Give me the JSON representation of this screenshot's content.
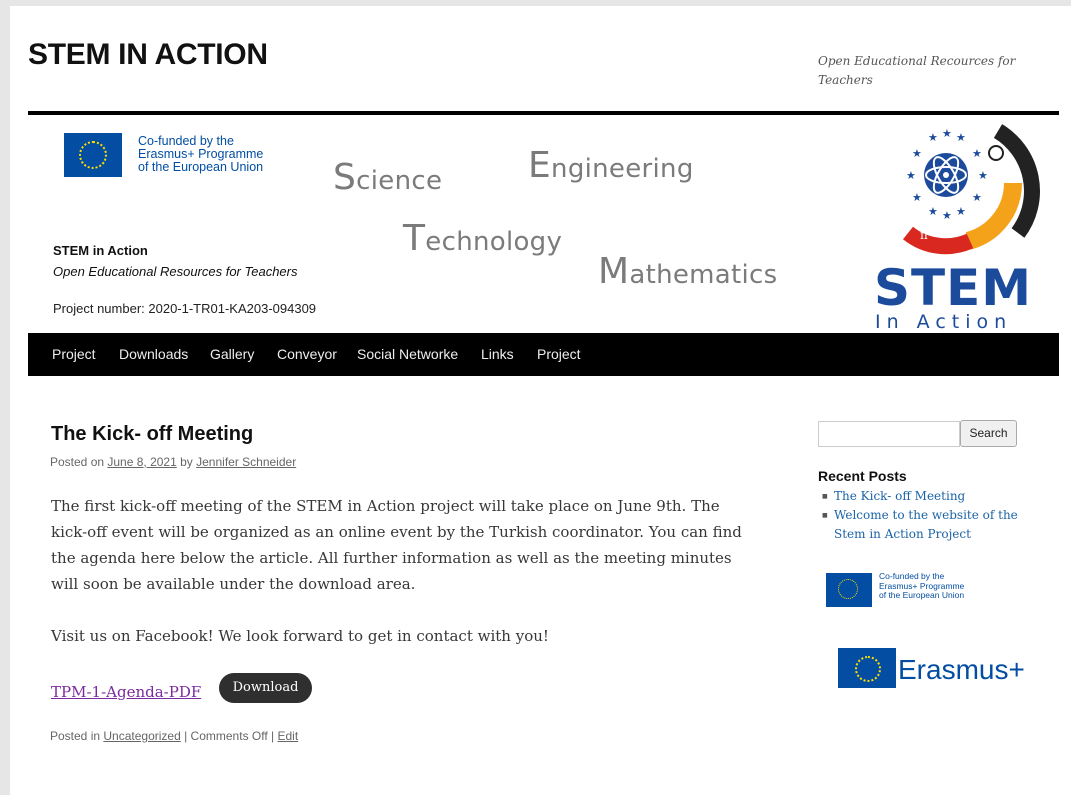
{
  "site": {
    "title": "STEM IN ACTION",
    "description": "Open Educational Recources for Teachers"
  },
  "banner": {
    "eu_text_line1": "Co-funded by the",
    "eu_text_line2": "Erasmus+ Programme",
    "eu_text_line3": "of the European Union",
    "words": {
      "science_cap": "S",
      "science_rest": "cience",
      "engineering_cap": "E",
      "engineering_rest": "ngineering",
      "technology_cap": "T",
      "technology_rest": "echnology",
      "mathematics_cap": "M",
      "mathematics_rest": "athematics"
    },
    "project_title": "STEM in Action",
    "project_subtitle": "Open Educational Resources for Teachers",
    "project_number": "Project number: 2020-1-TR01-KA203-094309",
    "logo_main": "STEM",
    "logo_sub": "In Action",
    "logo_pi": "π"
  },
  "nav": {
    "items": [
      "Project",
      "Downloads",
      "Gallery",
      "Conveyor",
      "Social Networke",
      "Links",
      "Project"
    ]
  },
  "post": {
    "title": "The Kick- off Meeting",
    "posted_on_prefix": "Posted on ",
    "date": "June 8, 2021",
    "by": " by ",
    "author": "Jennifer Schneider",
    "paragraph1": "The first kick-off meeting of the STEM in Action project will take place on June 9th. The kick-off event will be organized as an online event by the Turkish coordinator. You can find the agenda here below the article. All further information as well as the meeting minutes will soon be available under the download area.",
    "paragraph2": "Visit us on Facebook! We look forward to get in contact with you!",
    "attachment_link": "TPM-1-Agenda-PDF",
    "download_label": "Download",
    "posted_in_prefix": "Posted in ",
    "category": "Uncategorized",
    "comments": " | Comments Off | ",
    "edit": "Edit"
  },
  "sidebar": {
    "search_placeholder": "",
    "search_button": "Search",
    "recent_posts_title": "Recent Posts",
    "recent_posts": [
      "The Kick- off Meeting",
      "Welcome to the website of the Stem in Action Project"
    ],
    "eu_text_line1": "Co-funded by the",
    "eu_text_line2": "Erasmus+ Programme",
    "eu_text_line3": "of the European Union",
    "erasmus_label": "Erasmus+"
  },
  "colors": {
    "eu_blue": "#034ea2",
    "eu_yellow": "#ffdd00",
    "stem_blue": "#1c4b9c",
    "nav_bg": "#000000",
    "link_purple": "#7a2aa0",
    "link_blue": "#1b63a6"
  }
}
